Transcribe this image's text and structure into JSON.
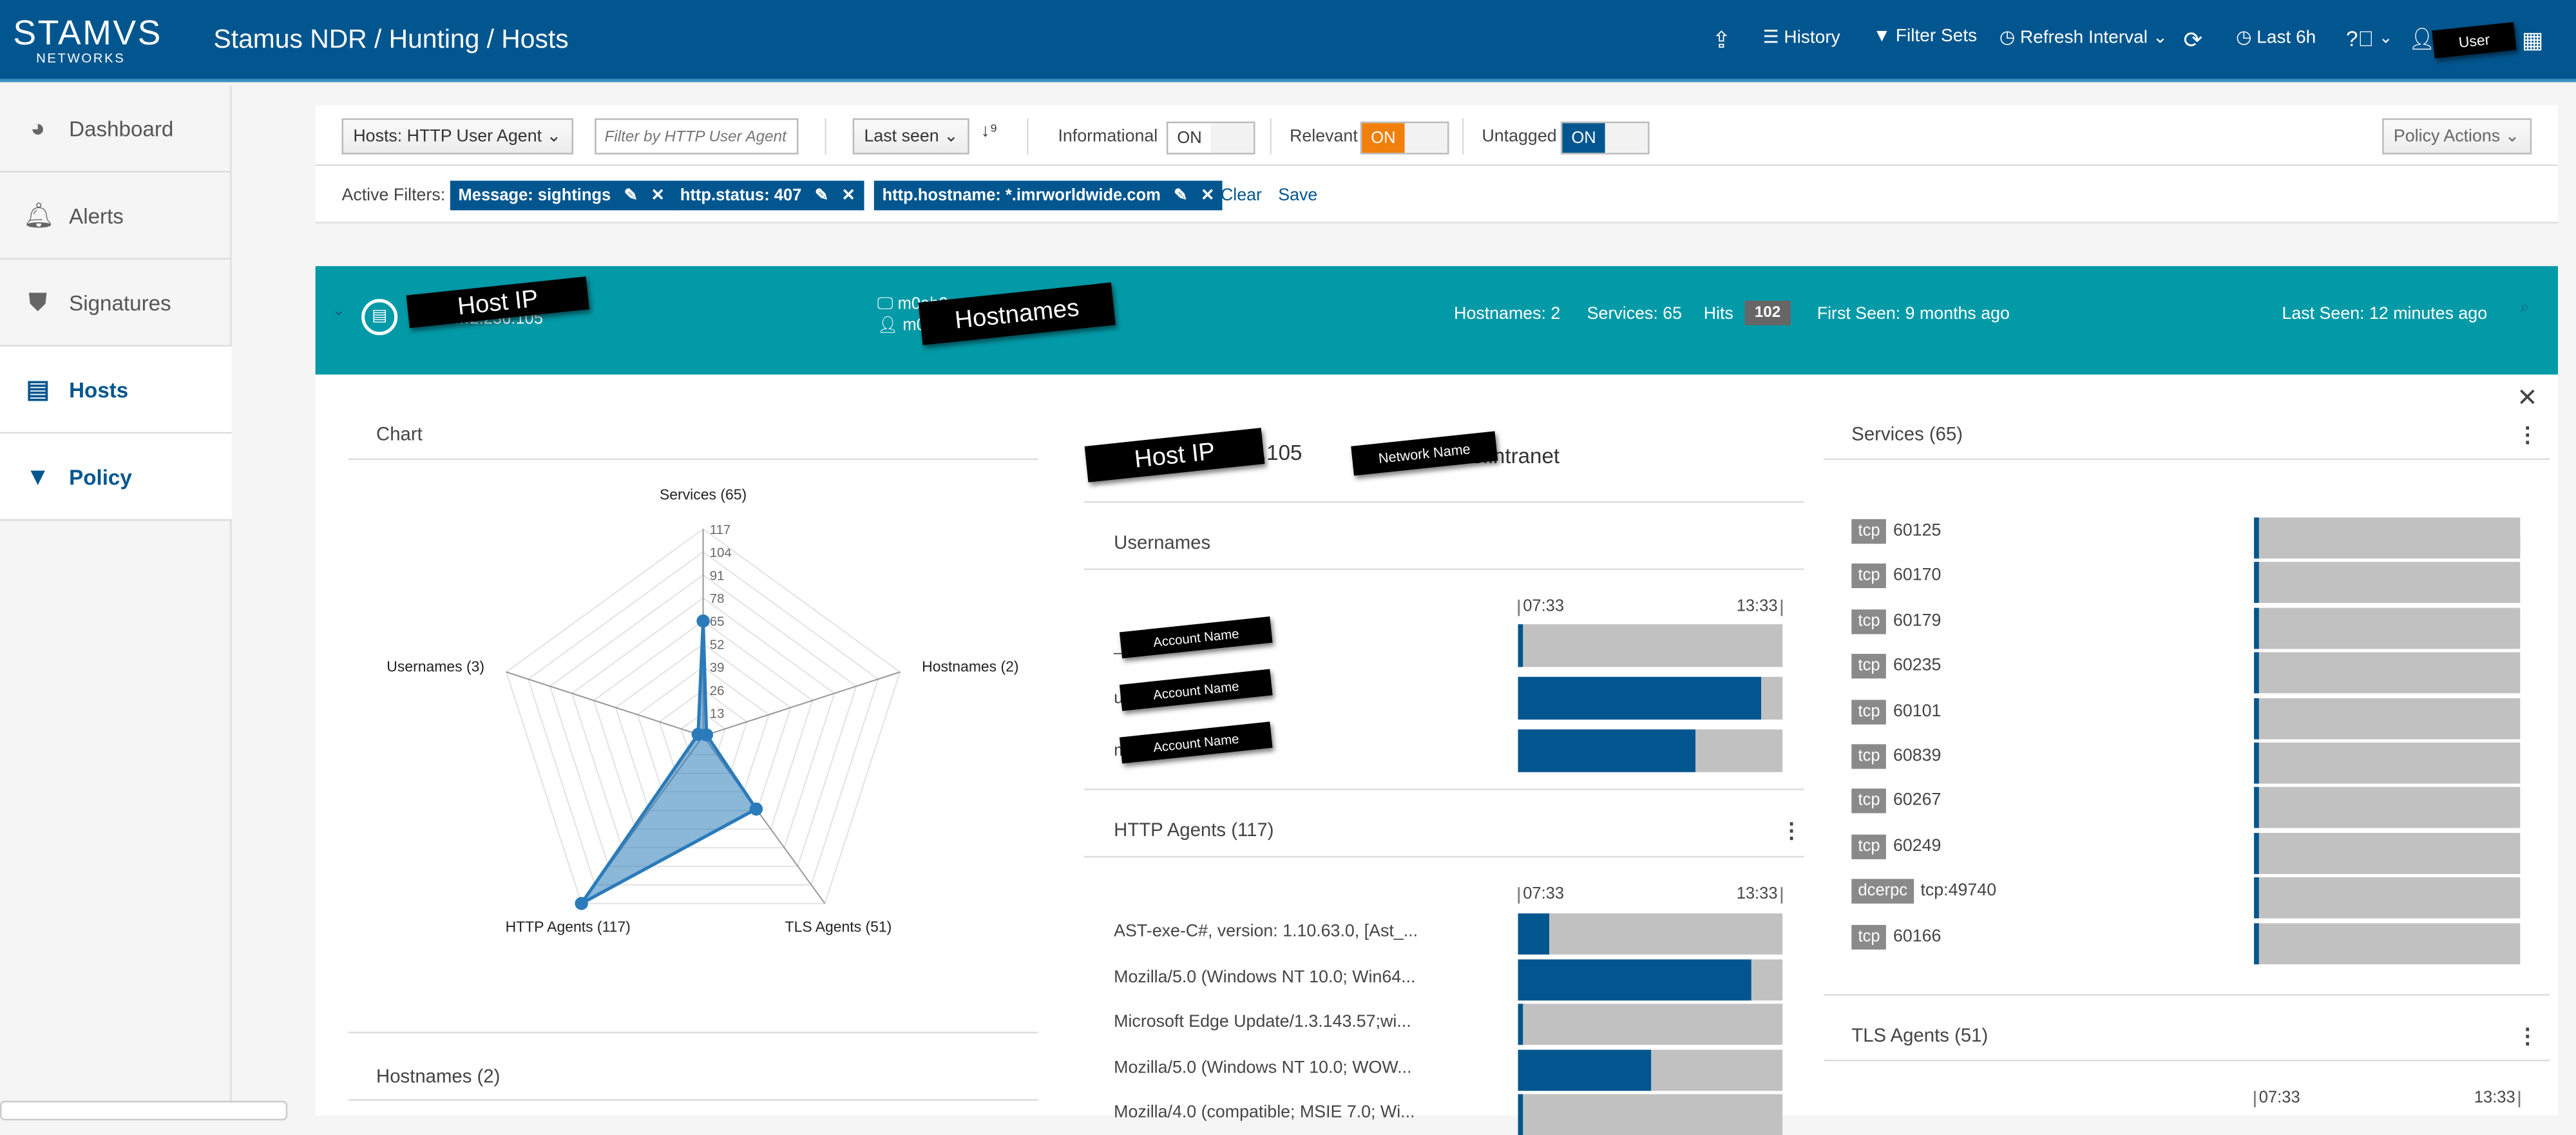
{
  "header": {
    "logo_text": "STAMVS",
    "logo_sub": "NETWORKS",
    "title": "Stamus NDR / Hunting / Hosts",
    "items": {
      "history": "History",
      "filter_sets": "Filter Sets",
      "refresh_interval": "Refresh Interval",
      "last": "Last 6h"
    },
    "user_redacted": "User"
  },
  "sidebar": {
    "items": [
      {
        "label": "Dashboard",
        "icon": "dashboard-icon"
      },
      {
        "label": "Alerts",
        "icon": "bell-icon"
      },
      {
        "label": "Signatures",
        "icon": "shield-icon"
      },
      {
        "label": "Hosts",
        "icon": "id-card-icon",
        "active": true
      },
      {
        "label": "Policy",
        "icon": "filter-icon"
      }
    ]
  },
  "toolbar": {
    "hosts_select": "Hosts: HTTP User Agent",
    "filter_placeholder": "Filter by HTTP User Agent",
    "sort_select": "Last seen",
    "informational": "Informational",
    "relevant": "Relevant",
    "untagged": "Untagged",
    "on": "ON",
    "policy_actions": "Policy Actions",
    "active_filters_label": "Active Filters:",
    "filters": [
      "Message: sightings",
      "http.status: 407",
      "http.hostname: *.imrworldwide.com"
    ],
    "clear": "Clear",
    "save": "Save"
  },
  "colors": {
    "brand": "#02568f",
    "teal": "#039aa8",
    "orange": "#f07f0b",
    "bar_bg": "#c1c1c1"
  },
  "host": {
    "ip_redacted": "Host IP",
    "ip_partial": "…2.236.105",
    "hostnames_redacted": "Hostnames",
    "hostname_partial": "m0ah2…",
    "user_partial": "m0",
    "hostnames_stat": "Hostnames: 2",
    "services_stat": "Services: 65",
    "hits_label": "Hits",
    "hits": "102",
    "first_seen": "First Seen: 9 months ago",
    "last_seen": "Last Seen: 12 minutes ago"
  },
  "chart_panel": {
    "title": "Chart"
  },
  "chart_data": {
    "type": "radar",
    "axes": [
      "Services (65)",
      "Hostnames (2)",
      "TLS Agents (51)",
      "HTTP Agents (117)",
      "Usernames (3)"
    ],
    "values": [
      65,
      2,
      51,
      117,
      3
    ],
    "ticks": [
      "13",
      "26",
      "39",
      "52",
      "65",
      "78",
      "91",
      "104",
      "117"
    ],
    "rmax": 117,
    "color": "#2b7bba"
  },
  "hostnames_panel": {
    "title": "Hostnames (2)"
  },
  "info": {
    "ip_redacted": "Host IP",
    "ip_partial": ".236.105",
    "network_redacted": "Network Name",
    "network_partial": "lients.intranet"
  },
  "time_axis": {
    "start": "07:33",
    "end": "13:33"
  },
  "usernames": {
    "title": "Usernames",
    "redacted": "Account Name",
    "rows": [
      {
        "label": "_e     service",
        "fill": 0.02
      },
      {
        "label": "u",
        "fill": 0.92
      },
      {
        "label": "m",
        "fill": 0.67
      }
    ]
  },
  "http_agents": {
    "title": "HTTP Agents (117)",
    "rows": [
      {
        "label": "AST-exe-C#, version: 1.10.63.0, [Ast_...",
        "fill": 0.12
      },
      {
        "label": "Mozilla/5.0 (Windows NT 10.0; Win64...",
        "fill": 0.88
      },
      {
        "label": "Microsoft Edge Update/1.3.143.57;wi...",
        "fill": 0.02
      },
      {
        "label": "Mozilla/5.0 (Windows NT 10.0; WOW...",
        "fill": 0.5
      },
      {
        "label": "Mozilla/4.0 (compatible; MSIE 7.0; Wi...",
        "fill": 0.02
      }
    ]
  },
  "services": {
    "title": "Services (65)",
    "rows": [
      {
        "proto": "tcp",
        "port": "60125",
        "fill": 0.01
      },
      {
        "proto": "tcp",
        "port": "60170",
        "fill": 0.01
      },
      {
        "proto": "tcp",
        "port": "60179",
        "fill": 0.01
      },
      {
        "proto": "tcp",
        "port": "60235",
        "fill": 0.01
      },
      {
        "proto": "tcp",
        "port": "60101",
        "fill": 0.01
      },
      {
        "proto": "tcp",
        "port": "60839",
        "fill": 0.01
      },
      {
        "proto": "tcp",
        "port": "60267",
        "fill": 0.01
      },
      {
        "proto": "tcp",
        "port": "60249",
        "fill": 0.01
      },
      {
        "proto": "dcerpc",
        "port": "tcp:49740",
        "fill": 0.01
      },
      {
        "proto": "tcp",
        "port": "60166",
        "fill": 0.01
      }
    ]
  },
  "tls_agents": {
    "title": "TLS Agents (51)"
  }
}
